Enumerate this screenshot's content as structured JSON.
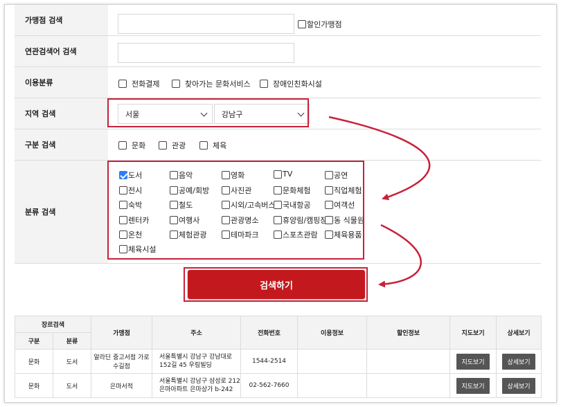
{
  "form": {
    "store_search": {
      "label": "가맹점 검색",
      "value": "",
      "discount_label": "할인가맹점",
      "discount_checked": false
    },
    "related_search": {
      "label": "연관검색어 검색",
      "value": ""
    },
    "usage": {
      "label": "이용분류",
      "options": [
        {
          "label": "전화결제",
          "checked": false
        },
        {
          "label": "찾아가는 문화서비스",
          "checked": false
        },
        {
          "label": "장애인친화시설",
          "checked": false
        }
      ]
    },
    "region": {
      "label": "지역 검색",
      "city": "서울",
      "district": "강남구"
    },
    "division": {
      "label": "구분 검색",
      "options": [
        {
          "label": "문화",
          "checked": false
        },
        {
          "label": "관광",
          "checked": false
        },
        {
          "label": "체육",
          "checked": false
        }
      ]
    },
    "category": {
      "label": "분류 검색",
      "options": [
        {
          "label": "도서",
          "checked": true
        },
        {
          "label": "음악",
          "checked": false
        },
        {
          "label": "영화",
          "checked": false
        },
        {
          "label": "TV",
          "checked": false
        },
        {
          "label": "공연",
          "checked": false
        },
        {
          "label": "전시",
          "checked": false
        },
        {
          "label": "공예/회방",
          "checked": false
        },
        {
          "label": "사진관",
          "checked": false
        },
        {
          "label": "문화체험",
          "checked": false
        },
        {
          "label": "직업체험",
          "checked": false
        },
        {
          "label": "숙박",
          "checked": false
        },
        {
          "label": "철도",
          "checked": false
        },
        {
          "label": "시외/고속버스",
          "checked": false
        },
        {
          "label": "국내항공",
          "checked": false
        },
        {
          "label": "여객선",
          "checked": false
        },
        {
          "label": "렌터카",
          "checked": false
        },
        {
          "label": "여행사",
          "checked": false
        },
        {
          "label": "관광명소",
          "checked": false
        },
        {
          "label": "휴양림/캠핑장",
          "checked": false
        },
        {
          "label": "동 식물원",
          "checked": false
        },
        {
          "label": "온천",
          "checked": false
        },
        {
          "label": "체험관광",
          "checked": false
        },
        {
          "label": "테마파크",
          "checked": false
        },
        {
          "label": "스포츠관람",
          "checked": false
        },
        {
          "label": "체육용품",
          "checked": false
        },
        {
          "label": "체육시설",
          "checked": false
        }
      ]
    },
    "search_button": "검색하기"
  },
  "results": {
    "headers": {
      "genre_group": "장르검색",
      "division": "구분",
      "category": "분류",
      "store": "가맹점",
      "address": "주소",
      "phone": "전화번호",
      "usage_info": "이용정보",
      "discount_info": "할인정보",
      "map": "지도보기",
      "detail": "상세보기"
    },
    "rows": [
      {
        "division": "문화",
        "category": "도서",
        "store": "알라딘 중고서점 가로수길점",
        "address": "서울특별시 강남구 강남대로152길 45 우림빌딩",
        "phone": "1544-2514",
        "usage_info": "",
        "discount_info": "",
        "map_btn": "지도보기",
        "detail_btn": "상세보기"
      },
      {
        "division": "문화",
        "category": "도서",
        "store": "은마서적",
        "address": "서울특별시 강남구 삼성로 212 은마아파트 은마상가 b-242",
        "phone": "02-562-7660",
        "usage_info": "",
        "discount_info": "",
        "map_btn": "지도보기",
        "detail_btn": "상세보기"
      }
    ]
  },
  "colors": {
    "highlight_red": "#c8203a",
    "button_red": "#c3181d",
    "checkbox_blue": "#2e7df6",
    "label_bg": "#f3f3f3"
  }
}
